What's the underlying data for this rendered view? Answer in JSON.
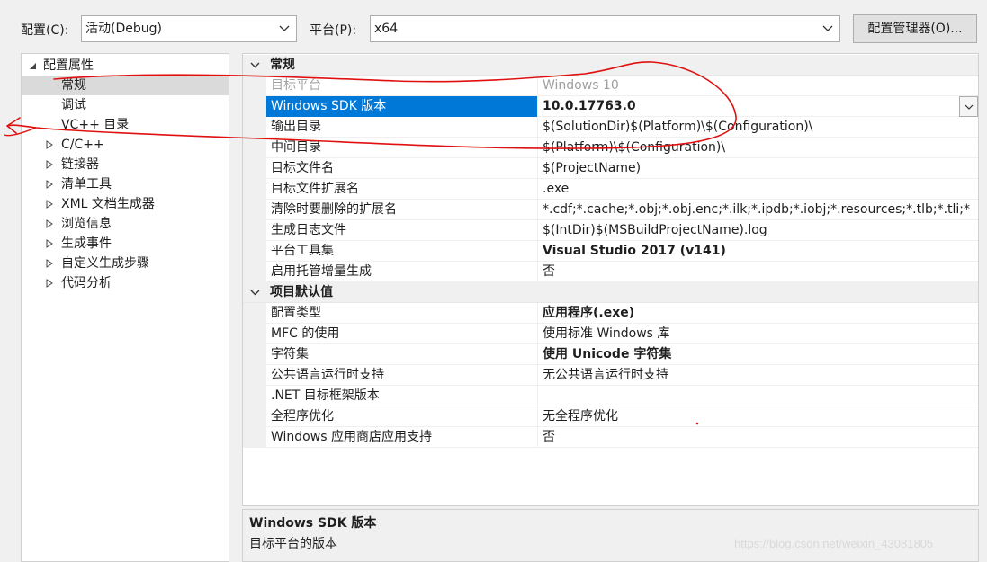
{
  "toolbar": {
    "config_label": "配置(C):",
    "config_value": "活动(Debug)",
    "platform_label": "平台(P):",
    "platform_value": "x64",
    "config_manager_button": "配置管理器(O)..."
  },
  "tree": {
    "items": [
      {
        "label": "配置属性",
        "level": 0,
        "expander": "expanded",
        "selected": false
      },
      {
        "label": "常规",
        "level": 1,
        "expander": "none",
        "selected": true
      },
      {
        "label": "调试",
        "level": 1,
        "expander": "none",
        "selected": false
      },
      {
        "label": "VC++ 目录",
        "level": 1,
        "expander": "none",
        "selected": false
      },
      {
        "label": "C/C++",
        "level": 1,
        "expander": "collapsed",
        "selected": false
      },
      {
        "label": "链接器",
        "level": 1,
        "expander": "collapsed",
        "selected": false
      },
      {
        "label": "清单工具",
        "level": 1,
        "expander": "collapsed",
        "selected": false
      },
      {
        "label": "XML 文档生成器",
        "level": 1,
        "expander": "collapsed",
        "selected": false
      },
      {
        "label": "浏览信息",
        "level": 1,
        "expander": "collapsed",
        "selected": false
      },
      {
        "label": "生成事件",
        "level": 1,
        "expander": "collapsed",
        "selected": false
      },
      {
        "label": "自定义生成步骤",
        "level": 1,
        "expander": "collapsed",
        "selected": false
      },
      {
        "label": "代码分析",
        "level": 1,
        "expander": "collapsed",
        "selected": false
      }
    ]
  },
  "grid": {
    "sections": [
      {
        "title": "常规",
        "rows": [
          {
            "name": "目标平台",
            "value": "Windows 10",
            "bold": false,
            "dim": true
          },
          {
            "name": "Windows SDK 版本",
            "value": "10.0.17763.0",
            "bold": true,
            "selected": true,
            "dropdown": true
          },
          {
            "name": "输出目录",
            "value": "$(SolutionDir)$(Platform)\\$(Configuration)\\",
            "bold": false
          },
          {
            "name": "中间目录",
            "value": "$(Platform)\\$(Configuration)\\",
            "bold": false
          },
          {
            "name": "目标文件名",
            "value": "$(ProjectName)",
            "bold": false
          },
          {
            "name": "目标文件扩展名",
            "value": ".exe",
            "bold": false
          },
          {
            "name": "清除时要删除的扩展名",
            "value": "*.cdf;*.cache;*.obj;*.obj.enc;*.ilk;*.ipdb;*.iobj;*.resources;*.tlb;*.tli;*",
            "bold": false
          },
          {
            "name": "生成日志文件",
            "value": "$(IntDir)$(MSBuildProjectName).log",
            "bold": false
          },
          {
            "name": "平台工具集",
            "value": "Visual Studio 2017 (v141)",
            "bold": true
          },
          {
            "name": "启用托管增量生成",
            "value": "否",
            "bold": false
          }
        ]
      },
      {
        "title": "项目默认值",
        "rows": [
          {
            "name": "配置类型",
            "value": "应用程序(.exe)",
            "bold": true
          },
          {
            "name": "MFC 的使用",
            "value": "使用标准 Windows 库",
            "bold": false
          },
          {
            "name": "字符集",
            "value": "使用 Unicode 字符集",
            "bold": true
          },
          {
            "name": "公共语言运行时支持",
            "value": "无公共语言运行时支持",
            "bold": false
          },
          {
            "name": ".NET 目标框架版本",
            "value": "",
            "bold": false
          },
          {
            "name": "全程序优化",
            "value": "无全程序优化",
            "bold": false
          },
          {
            "name": "Windows 应用商店应用支持",
            "value": "否",
            "bold": false
          }
        ]
      }
    ]
  },
  "description": {
    "title": "Windows SDK 版本",
    "text": "目标平台的版本"
  },
  "watermark": "https://blog.csdn.net/weixin_43081805",
  "colors": {
    "selection": "#0078d7",
    "tree_selection": "#dadada",
    "annotation": "#e01010"
  },
  "icons": {
    "dropdown": "chevron-down-icon",
    "tree_expanded": "triangle-expanded-icon",
    "tree_collapsed": "triangle-collapsed-icon",
    "section_collapse": "chevron-down-icon"
  }
}
